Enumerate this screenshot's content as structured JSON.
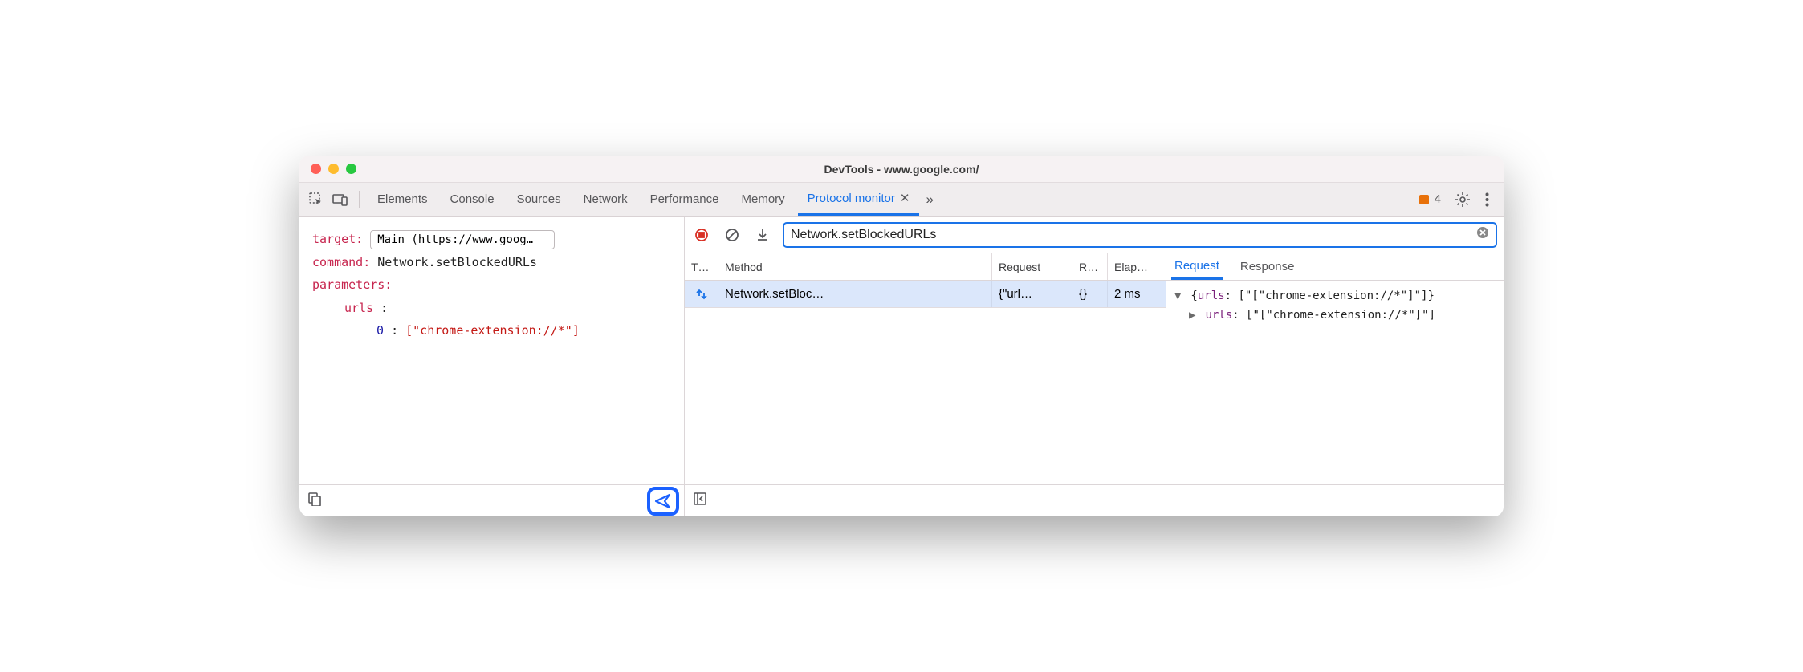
{
  "window": {
    "title": "DevTools - www.google.com/"
  },
  "tabs": {
    "elements": "Elements",
    "console": "Console",
    "sources": "Sources",
    "network": "Network",
    "performance": "Performance",
    "memory": "Memory",
    "protocol_monitor": "Protocol monitor"
  },
  "warnings_count": "4",
  "left": {
    "target_label": "target:",
    "target_value": "Main (https://www.goog…",
    "command_label": "command:",
    "command_value": "Network.setBlockedURLs",
    "parameters_label": "parameters:",
    "param_urls_label": "urls",
    "param_index": "0",
    "param_value": "[\"chrome-extension://*\"]"
  },
  "search": {
    "value": "Network.setBlockedURLs"
  },
  "log": {
    "headers": {
      "t": "T…",
      "method": "Method",
      "request": "Request",
      "r": "R…",
      "elapsed": "Elap…"
    },
    "rows": [
      {
        "method": "Network.setBloc…",
        "request": "{\"url…",
        "r": "{}",
        "elapsed": "2 ms"
      }
    ]
  },
  "details": {
    "tabs": {
      "request": "Request",
      "response": "Response"
    },
    "line1_prop": "urls",
    "line1_value": "[\"[\"chrome-extension://*\"]\"]",
    "line2_prop": "urls",
    "line2_value": "[\"[\"chrome-extension://*\"]\"]"
  }
}
